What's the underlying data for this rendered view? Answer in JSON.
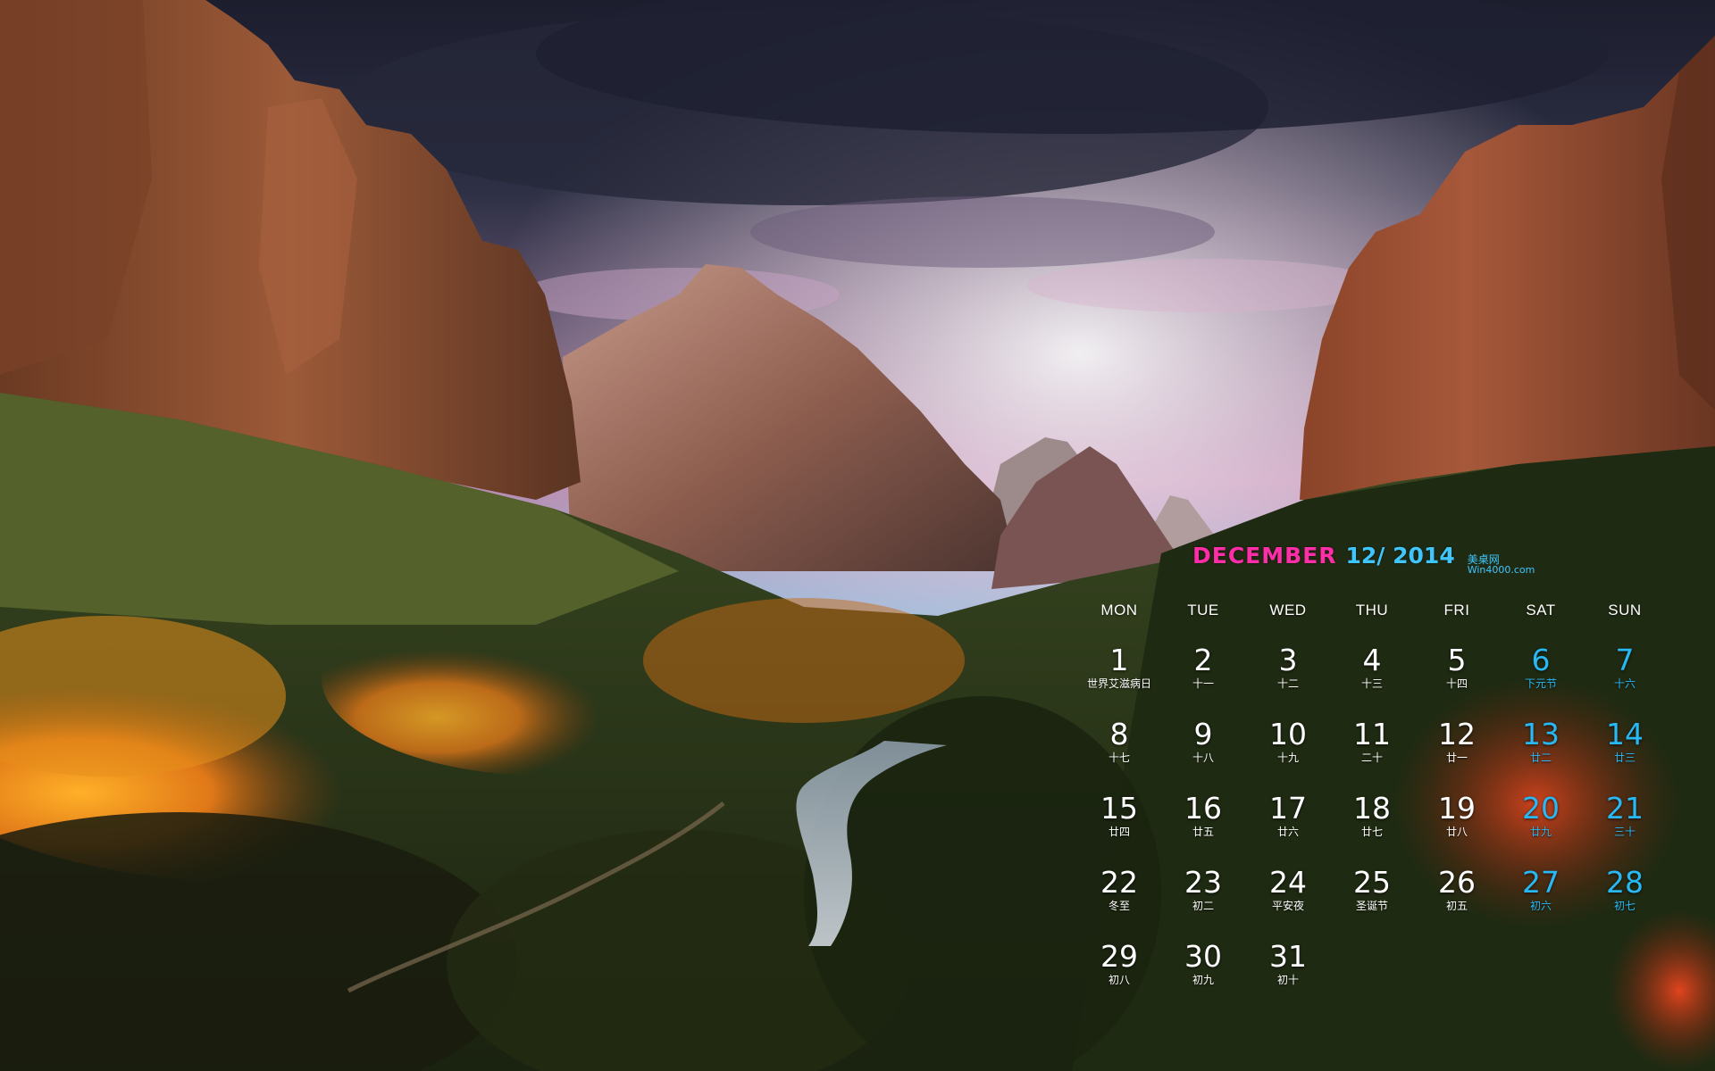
{
  "calendar": {
    "month_label": "DECEMBER",
    "number_label": "12/ 2014",
    "brand_cn": "美桌网",
    "brand_url": "Win4000.com",
    "weekdays": [
      "MON",
      "TUE",
      "WED",
      "THU",
      "FRI",
      "SAT",
      "SUN"
    ],
    "days": [
      {
        "d": "1",
        "l": "世界艾滋病日"
      },
      {
        "d": "2",
        "l": "十一"
      },
      {
        "d": "3",
        "l": "十二"
      },
      {
        "d": "4",
        "l": "十三"
      },
      {
        "d": "5",
        "l": "十四"
      },
      {
        "d": "6",
        "l": "下元节"
      },
      {
        "d": "7",
        "l": "十六"
      },
      {
        "d": "8",
        "l": "十七"
      },
      {
        "d": "9",
        "l": "十八"
      },
      {
        "d": "10",
        "l": "十九"
      },
      {
        "d": "11",
        "l": "二十"
      },
      {
        "d": "12",
        "l": "廿一"
      },
      {
        "d": "13",
        "l": "廿二"
      },
      {
        "d": "14",
        "l": "廿三"
      },
      {
        "d": "15",
        "l": "廿四"
      },
      {
        "d": "16",
        "l": "廿五"
      },
      {
        "d": "17",
        "l": "廿六"
      },
      {
        "d": "18",
        "l": "廿七"
      },
      {
        "d": "19",
        "l": "廿八"
      },
      {
        "d": "20",
        "l": "廿九"
      },
      {
        "d": "21",
        "l": "三十"
      },
      {
        "d": "22",
        "l": "冬至"
      },
      {
        "d": "23",
        "l": "初二"
      },
      {
        "d": "24",
        "l": "平安夜"
      },
      {
        "d": "25",
        "l": "圣诞节"
      },
      {
        "d": "26",
        "l": "初五"
      },
      {
        "d": "27",
        "l": "初六"
      },
      {
        "d": "28",
        "l": "初七"
      },
      {
        "d": "29",
        "l": "初八"
      },
      {
        "d": "30",
        "l": "初九"
      },
      {
        "d": "31",
        "l": "初十"
      }
    ]
  },
  "colors": {
    "month_text": "#ff2ea8",
    "accent_text": "#3fc6ff",
    "weekend_text": "#27b9f5",
    "weekday_text": "#ffffff"
  }
}
